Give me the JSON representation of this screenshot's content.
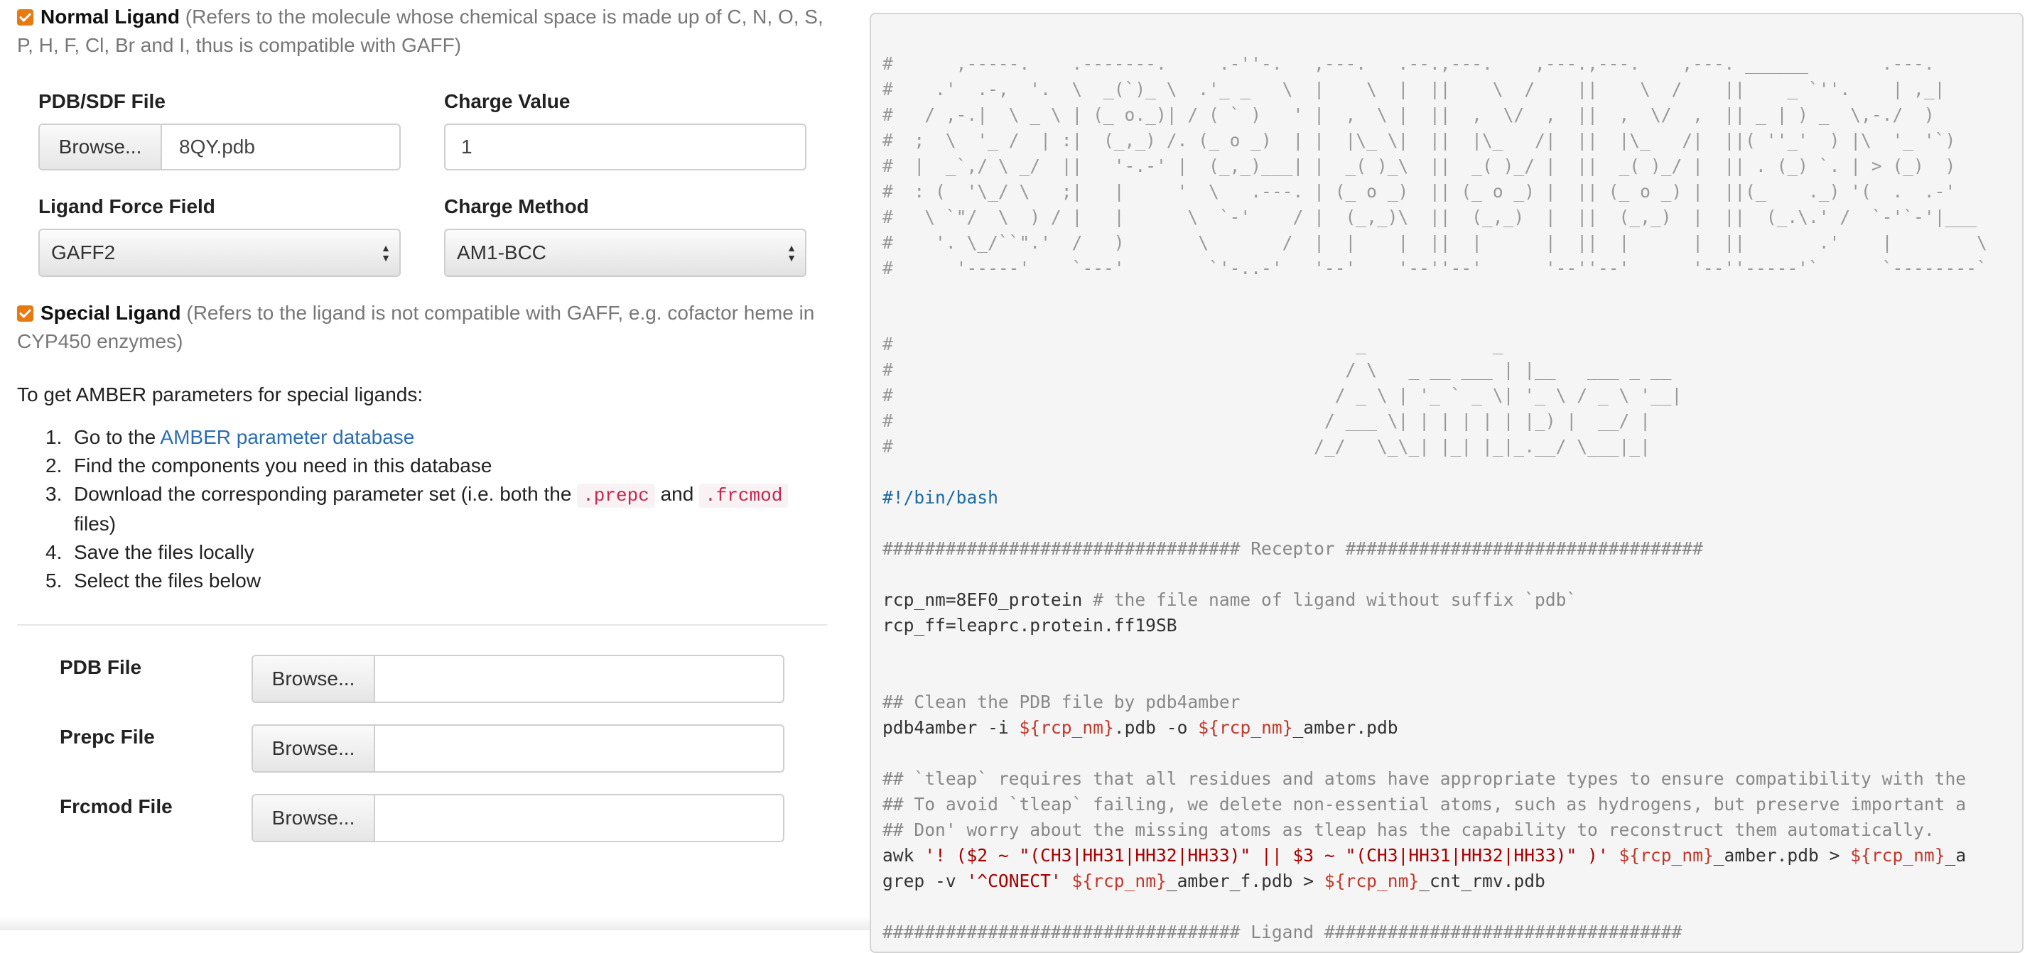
{
  "normal_ligand": {
    "title": "Normal Ligand",
    "desc_line1": "(Refers to the molecule whose chemical space is made up of C, N, O, S,",
    "desc_line2": "P, H, F, Cl, Br and I, thus is compatible with GAFF)",
    "checked": true
  },
  "pdb_sdf": {
    "label": "PDB/SDF File",
    "browse_label": "Browse...",
    "filename": "8QY.pdb"
  },
  "charge_value": {
    "label": "Charge Value",
    "value": "1"
  },
  "ligand_ff": {
    "label": "Ligand Force Field",
    "selected": "GAFF2"
  },
  "charge_method": {
    "label": "Charge Method",
    "selected": "AM1-BCC"
  },
  "special_ligand": {
    "title": "Special Ligand",
    "desc_line1": "(Refers to the ligand is not compatible with GAFF, e.g. cofactor heme in",
    "desc_line2": "CYP450 enzymes)",
    "checked": true
  },
  "intro": "To get AMBER parameters for special ligands:",
  "steps": {
    "s1_num": "1.",
    "s1_pre": "Go to the ",
    "s1_link": "AMBER parameter database",
    "s2_num": "2.",
    "s2": "Find the components you need in this database",
    "s3_num": "3.",
    "s3_pre": "Download the corresponding parameter set (i.e. both the ",
    "s3_code1": ".prepc",
    "s3_mid": " and ",
    "s3_code2": ".frcmod",
    "s3_post": "files)",
    "s4_num": "4.",
    "s4": "Save the files locally",
    "s5_num": "5.",
    "s5": "Select the files below"
  },
  "file_inputs": {
    "pdb": {
      "label": "PDB File",
      "browse_label": "Browse...",
      "filename": ""
    },
    "prepc": {
      "label": "Prepc File",
      "browse_label": "Browse...",
      "filename": ""
    },
    "frcmod": {
      "label": "Frcmod File",
      "browse_label": "Browse...",
      "filename": ""
    }
  },
  "code": {
    "art1": [
      "#      ,-----.    .-------.     .-''-.   ,---.   .--.,---.    ,---.,---.    ,---. ______       .---.",
      "#    .'  .-,  '.  \\  _(`)_ \\  .'_ _   \\  |    \\  |  ||    \\  /    ||    \\  /    ||    _ `''.    | ,_|",
      "#   / ,-.|  \\ _ \\ | (_ o._)| / ( ` )   ' |  ,  \\ |  ||  ,  \\/  ,  ||  ,  \\/  ,  || _ | ) _  \\,-./  )",
      "#  ;  \\  '_ /  | :|  (_,_) /. (_ o _)  | |  |\\_ \\|  ||  |\\_   /|  ||  |\\_   /|  ||( ''_'  ) |\\  '_ '`)",
      "#  |  _`,/ \\ _/  ||   '-.-' |  (_,_)___| |  _( )_\\  ||  _( )_/ |  ||  _( )_/ |  || . (_) `. | > (_)  )",
      "#  : (  '\\_/ \\   ;|   |     '  \\   .---. | (_ o _)  || (_ o _) |  || (_ o _) |  ||(_    ._) '(  .  .-'",
      "#   \\ `\"/  \\  ) / |   |      \\  `-'    / |  (_,_)\\  ||  (_,_)  |  ||  (_,_)  |  ||  (_.\\.' /  `-'`-'|___",
      "#    '. \\_/``\".'  /   )       \\       /  |  |    |  ||  |      |  ||  |      |  ||       .'    |        \\",
      "#      '-----'    `---'        `'-..-'   '--'    '--''--'      '--''--'      '--''-----'`      `--------`"
    ],
    "art2": [
      "#                                            _            _",
      "#                                           / \\   _ __ ___ | |__   ___ _ __",
      "#                                          / _ \\ | '_ ` _ \\| '_ \\ / _ \\ '__|",
      "#                                         / ___ \\| | | | | | |_) |  __/ |",
      "#                                        /_/   \\_\\_| |_| |_|_.__/ \\___|_|"
    ],
    "shebang": "#!/bin/bash",
    "receptor_header": "################################## Receptor ##################################",
    "rcp_nm_code": "rcp_nm=8EF0_protein ",
    "rcp_nm_comment": "# the file name of ligand without suffix `pdb`",
    "rcp_ff": "rcp_ff=leaprc.protein.ff19SB",
    "clean_comment": "## Clean the PDB file by pdb4amber",
    "pdb4amber_1": "pdb4amber -i ",
    "pdb4amber_var1": "${rcp_nm}",
    "pdb4amber_2": ".pdb -o ",
    "pdb4amber_var2": "${rcp_nm}",
    "pdb4amber_3": "_amber.pdb",
    "tleap_c1": "## `tleap` requires that all residues and atoms have appropriate types to ensure compatibility with the",
    "tleap_c2": "## To avoid `tleap` failing, we delete non-essential atoms, such as hydrogens, but preserve important a",
    "tleap_c3": "## Don' worry about the missing atoms as tleap has the capability to reconstruct them automatically.",
    "awk_1": "awk ",
    "awk_str": "'! ($2 ~ \"(CH3|HH31|HH32|HH33)\" || $3 ~ \"(CH3|HH31|HH32|HH33)\" )'",
    "awk_sp": " ",
    "awk_var1": "${rcp_nm}",
    "awk_2": "_amber.pdb > ",
    "awk_var2": "${rcp_nm}",
    "awk_3": "_a",
    "grep_1": "grep -v ",
    "grep_str": "'^CONECT'",
    "grep_sp": " ",
    "grep_var1": "${rcp_nm}",
    "grep_2": "_amber_f.pdb > ",
    "grep_var2": "${rcp_nm}",
    "grep_3": "_cnt_rmv.pdb",
    "ligand_header": "################################## Ligand ##################################"
  }
}
